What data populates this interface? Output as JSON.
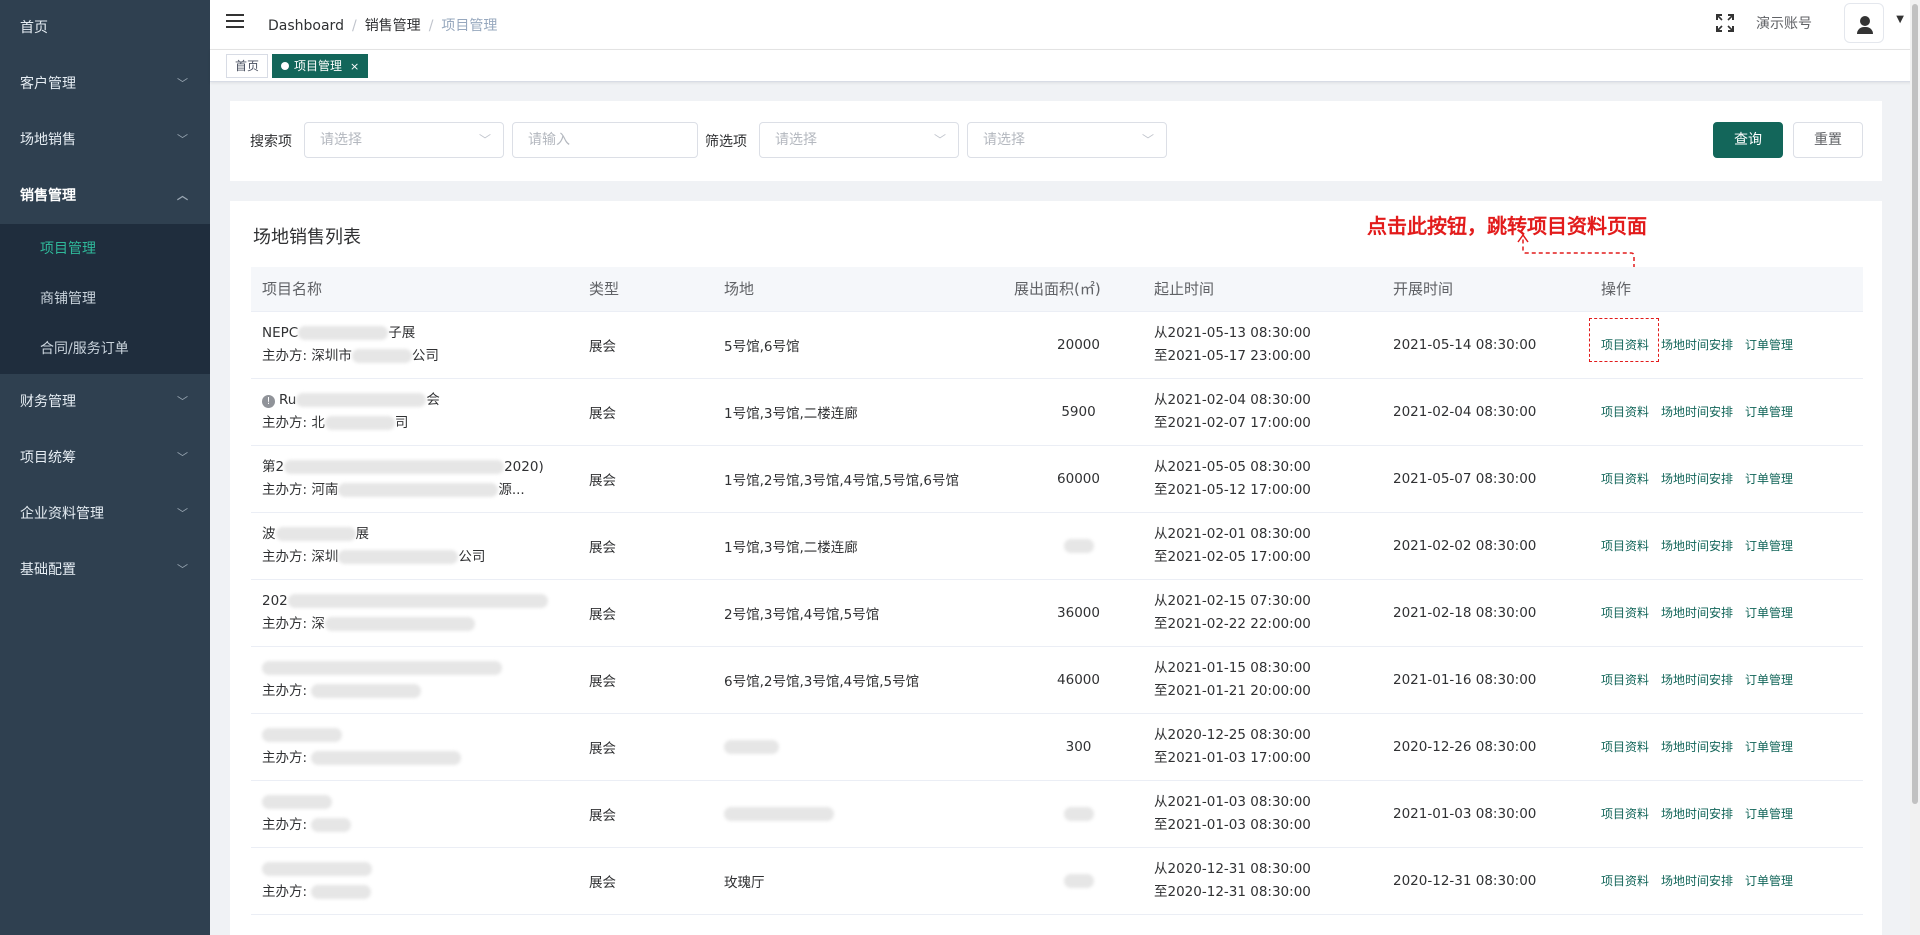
{
  "sidebar": {
    "items": [
      {
        "label": "首页",
        "has_children": false
      },
      {
        "label": "客户管理",
        "has_children": true
      },
      {
        "label": "场地销售",
        "has_children": true
      },
      {
        "label": "销售管理",
        "has_children": true,
        "open": true
      },
      {
        "label": "财务管理",
        "has_children": true
      },
      {
        "label": "项目统筹",
        "has_children": true
      },
      {
        "label": "企业资料管理",
        "has_children": true
      },
      {
        "label": "基础配置",
        "has_children": true
      }
    ],
    "sub_items": [
      "项目管理",
      "商铺管理",
      "合同/服务订单"
    ],
    "active_sub": "项目管理"
  },
  "header": {
    "breadcrumb": [
      "Dashboard",
      "销售管理",
      "项目管理"
    ],
    "account_name": "演示账号"
  },
  "tags": {
    "home": "首页",
    "active": "项目管理",
    "close_glyph": "×"
  },
  "search": {
    "label1": "搜索项",
    "select1_placeholder": "请选择",
    "input_placeholder": "请输入",
    "label2": "筛选项",
    "select2_placeholder": "请选择",
    "select3_placeholder": "请选择",
    "query_label": "查询",
    "reset_label": "重置"
  },
  "list": {
    "title": "场地销售列表",
    "annotation": "点击此按钮，跳转项目资料页面",
    "columns": [
      "项目名称",
      "类型",
      "场地",
      "展出面积(㎡)",
      "起止时间",
      "开展时间",
      "操作"
    ],
    "actions": [
      "项目资料",
      "场地时间安排",
      "订单管理"
    ],
    "rows": [
      {
        "name_a": "NEPC",
        "name_b": "子展",
        "org_a": "主办方: 深圳市",
        "org_b": "公司",
        "type": "展会",
        "venue": "5号馆,6号馆",
        "area": "20000",
        "from": "从2021-05-13 08:30:00",
        "to": "至2021-05-17 23:00:00",
        "start": "2021-05-14 08:30:00"
      },
      {
        "name_a": "Ru",
        "name_b": "会",
        "org_a": "主办方: 北",
        "org_b": "司",
        "type": "展会",
        "venue": "1号馆,3号馆,二楼连廊",
        "area": "5900",
        "from": "从2021-02-04 08:30:00",
        "to": "至2021-02-07 17:00:00",
        "start": "2021-02-04 08:30:00",
        "warn": true
      },
      {
        "name_a": "第2",
        "name_b": "2020)",
        "org_a": "主办方: 河南",
        "org_b": "源...",
        "type": "展会",
        "venue": "1号馆,2号馆,3号馆,4号馆,5号馆,6号馆",
        "area": "60000",
        "from": "从2021-05-05 08:30:00",
        "to": "至2021-05-12 17:00:00",
        "start": "2021-05-07 08:30:00"
      },
      {
        "name_a": "波",
        "name_b": "展",
        "org_a": "主办方: 深圳",
        "org_b": "公司",
        "type": "展会",
        "venue": "1号馆,3号馆,二楼连廊",
        "area": "",
        "from": "从2021-02-01 08:30:00",
        "to": "至2021-02-05 17:00:00",
        "start": "2021-02-02 08:30:00"
      },
      {
        "name_a": "202",
        "name_b": "",
        "org_a": "主办方: 深",
        "org_b": "",
        "type": "展会",
        "venue": "2号馆,3号馆,4号馆,5号馆",
        "area": "36000",
        "from": "从2021-02-15 07:30:00",
        "to": "至2021-02-22 22:00:00",
        "start": "2021-02-18 08:30:00"
      },
      {
        "name_a": "",
        "name_b": "",
        "org_a": "主办方: ",
        "org_b": "",
        "type": "展会",
        "venue": "6号馆,2号馆,3号馆,4号馆,5号馆",
        "area": "46000",
        "from": "从2021-01-15 08:30:00",
        "to": "至2021-01-21 20:00:00",
        "start": "2021-01-16 08:30:00"
      },
      {
        "name_a": "",
        "name_b": "",
        "org_a": "主办方: ",
        "org_b": "",
        "type": "展会",
        "venue": "",
        "area": "300",
        "from": "从2020-12-25 08:30:00",
        "to": "至2021-01-03 17:00:00",
        "start": "2020-12-26 08:30:00"
      },
      {
        "name_a": "",
        "name_b": "",
        "org_a": "主办方: ",
        "org_b": "",
        "type": "展会",
        "venue": "",
        "area": "",
        "from": "从2021-01-03 08:30:00",
        "to": "至2021-01-03 08:30:00",
        "start": "2021-01-03 08:30:00"
      },
      {
        "name_a": "",
        "name_b": "",
        "org_a": "主办方: ",
        "org_b": "",
        "type": "展会",
        "venue": "玫瑰厅",
        "area": "",
        "from": "从2020-12-31 08:30:00",
        "to": "至2020-12-31 08:30:00",
        "start": "2020-12-31 08:30:00"
      }
    ]
  },
  "colors": {
    "accent": "#13665a",
    "sidebar_bg": "#2f4050",
    "annotation": "#e21b1b"
  }
}
